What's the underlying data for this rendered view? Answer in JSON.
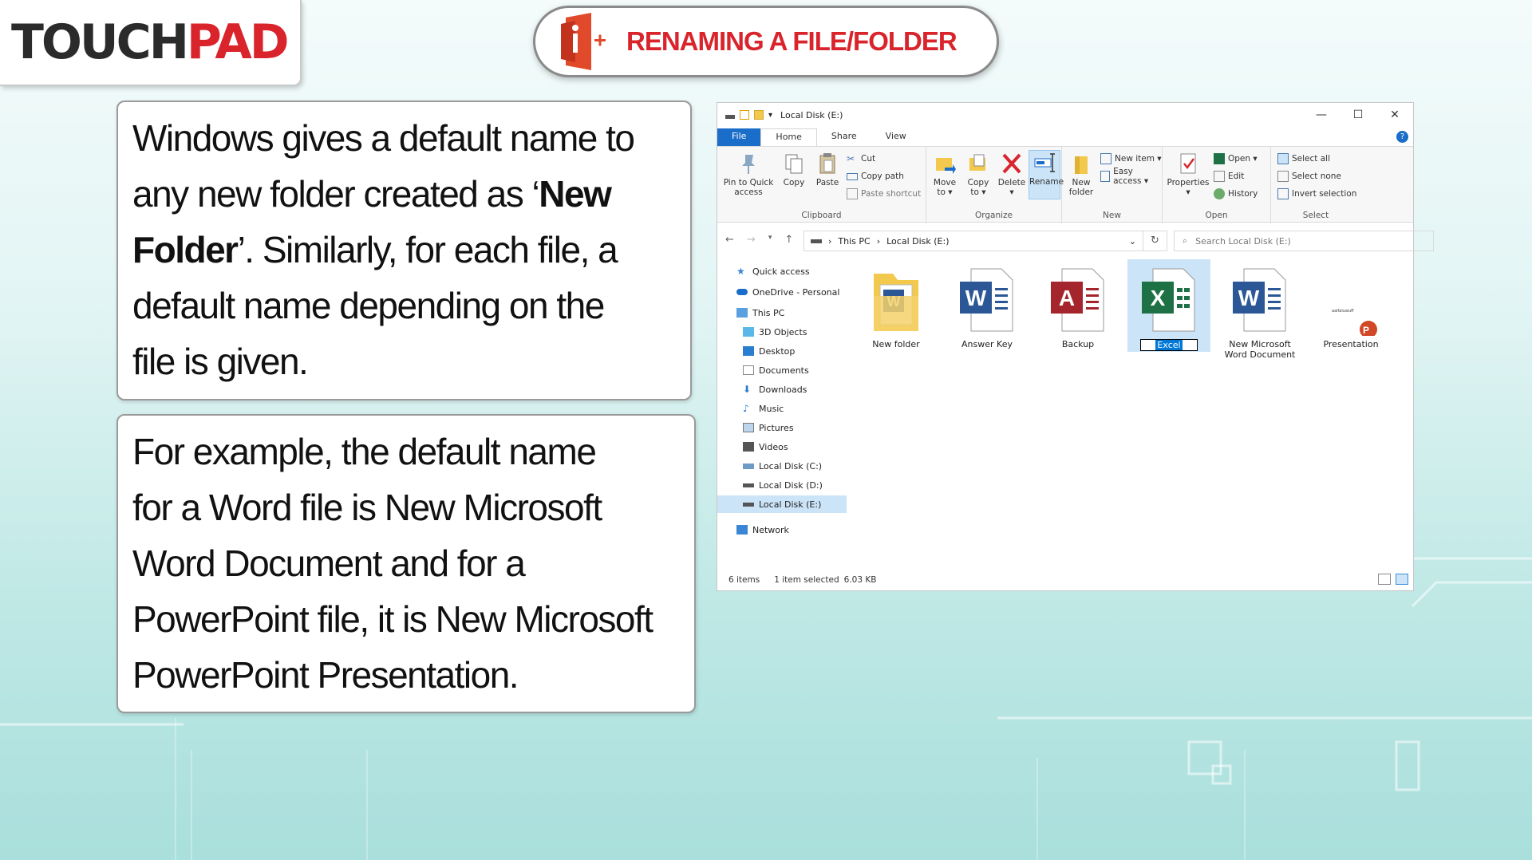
{
  "logo": {
    "part_a": "TOUCH",
    "part_b": "PAD"
  },
  "header": {
    "title": "RENAMING A FILE/FOLDER",
    "accent": "#d9242c"
  },
  "text_blocks": {
    "block1": {
      "line1": "Windows gives a default name to",
      "line2a": "any new folder created as ‘",
      "line2b": "New",
      "line3a": "Folder",
      "line3b": "’. Similarly, for each file, a",
      "line4": "default name depending on the",
      "line5": "file is given."
    },
    "block2": {
      "line1": "For example, the default name",
      "line2": "for a Word file is New Microsoft",
      "line3": "Word Document and for a",
      "line4": "PowerPoint file, it is New Microsoft",
      "line5": "PowerPoint Presentation."
    }
  },
  "explorer": {
    "window_title": "Local Disk (E:)",
    "controls": {
      "minimize": "—",
      "maximize": "☐",
      "close": "✕"
    },
    "tabs": [
      "File",
      "Home",
      "Share",
      "View"
    ],
    "help": "?",
    "ribbon": {
      "clipboard": {
        "label": "Clipboard",
        "pin": "Pin to Quick",
        "pin2": "access",
        "copy": "Copy",
        "paste": "Paste",
        "cut": "Cut",
        "copy_path": "Copy path",
        "paste_shortcut": "Paste shortcut"
      },
      "organize": {
        "label": "Organize",
        "move": "Move",
        "move2": "to ▾",
        "copyto": "Copy",
        "copyto2": "to ▾",
        "delete": "Delete",
        "delete2": "▾",
        "rename": "Rename"
      },
      "new": {
        "label": "New",
        "new_folder": "New",
        "new_folder2": "folder",
        "new_item": "New item ▾",
        "easy_access": "Easy access ▾"
      },
      "open": {
        "label": "Open",
        "properties": "Properties",
        "properties2": "▾",
        "open": "Open ▾",
        "edit": "Edit",
        "history": "History"
      },
      "select": {
        "label": "Select",
        "select_all": "Select all",
        "select_none": "Select none",
        "invert": "Invert selection"
      }
    },
    "address": {
      "path1": "This PC",
      "path2": "Local Disk (E:)",
      "search_placeholder": "Search Local Disk (E:)"
    },
    "nav": [
      "Quick access",
      "OneDrive - Personal",
      "This PC",
      "3D Objects",
      "Desktop",
      "Documents",
      "Downloads",
      "Music",
      "Pictures",
      "Videos",
      "Local Disk (C:)",
      "Local Disk (D:)",
      "Local Disk (E:)",
      "Network"
    ],
    "files": {
      "f1": "New folder",
      "f2": "Answer Key",
      "f3": "Backup",
      "f4": "Excel",
      "f5a": "New Microsoft",
      "f5b": "Word Document",
      "f6": "Presentation",
      "f6_small": "aalfaluwuff"
    },
    "status": {
      "items": "6 items",
      "selected": "1 item selected",
      "size": "6.03 KB"
    },
    "colors": {
      "word": "#2b5797",
      "excel": "#1e7145",
      "access": "#a4262c",
      "ppt": "#d24726",
      "accent": "#1a6dc8"
    }
  }
}
